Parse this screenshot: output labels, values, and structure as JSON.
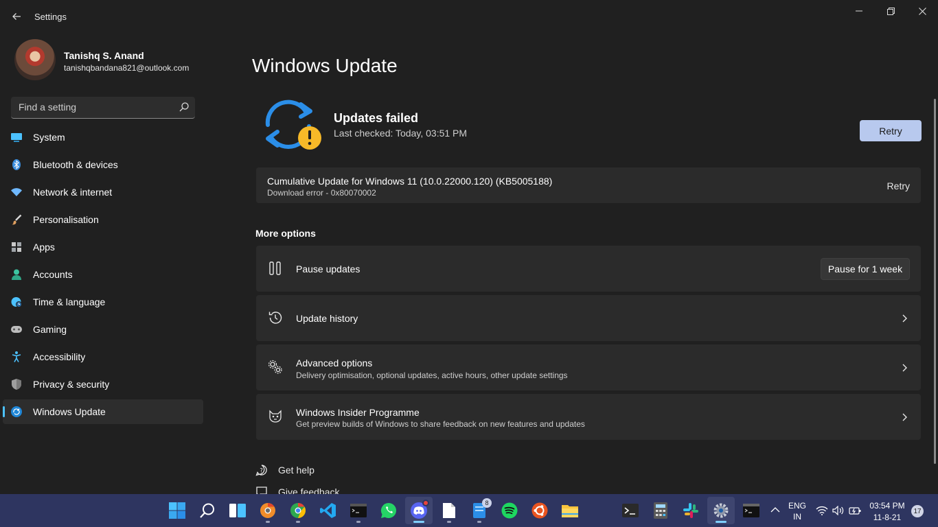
{
  "window": {
    "title": "Settings",
    "controls": [
      "minimize",
      "restore",
      "close"
    ]
  },
  "profile": {
    "name": "Tanishq S. Anand",
    "email": "tanishqbandana821@outlook.com"
  },
  "search": {
    "placeholder": "Find a setting"
  },
  "sidebar": {
    "items": [
      {
        "label": "System",
        "icon": "monitor-icon",
        "color": "#4cc2ff"
      },
      {
        "label": "Bluetooth & devices",
        "icon": "bluetooth-icon",
        "color": "#3a8dde"
      },
      {
        "label": "Network & internet",
        "icon": "wifi-icon",
        "color": "#6fb8ff"
      },
      {
        "label": "Personalisation",
        "icon": "brush-icon",
        "color": "#e0a060"
      },
      {
        "label": "Apps",
        "icon": "apps-icon",
        "color": "#c8c8c8"
      },
      {
        "label": "Accounts",
        "icon": "person-icon",
        "color": "#3cc5a0"
      },
      {
        "label": "Time & language",
        "icon": "globe-clock-icon",
        "color": "#4cc2ff"
      },
      {
        "label": "Gaming",
        "icon": "gamepad-icon",
        "color": "#bdbdbd"
      },
      {
        "label": "Accessibility",
        "icon": "accessibility-icon",
        "color": "#4cc2ff"
      },
      {
        "label": "Privacy & security",
        "icon": "shield-icon",
        "color": "#9e9e9e"
      },
      {
        "label": "Windows Update",
        "icon": "update-icon",
        "color": "#4cc2ff",
        "active": true
      }
    ]
  },
  "main": {
    "title": "Windows Update",
    "status": {
      "title": "Updates failed",
      "subtitle": "Last checked: Today, 03:51 PM",
      "retry_label": "Retry"
    },
    "update_item": {
      "title": "Cumulative Update for Windows 11 (10.0.22000.120) (KB5005188)",
      "subtitle": "Download error - 0x80070002",
      "retry_label": "Retry"
    },
    "more_options_label": "More options",
    "options": [
      {
        "title": "Pause updates",
        "subtitle": "",
        "action_label": "Pause for 1 week",
        "icon": "pause-icon"
      },
      {
        "title": "Update history",
        "subtitle": "",
        "icon": "history-icon"
      },
      {
        "title": "Advanced options",
        "subtitle": "Delivery optimisation, optional updates, active hours, other update settings",
        "icon": "gears-icon"
      },
      {
        "title": "Windows Insider Programme",
        "subtitle": "Get preview builds of Windows to share feedback on new features and updates",
        "icon": "insider-cat-icon"
      }
    ],
    "links": [
      {
        "label": "Get help",
        "icon": "help-icon"
      },
      {
        "label": "Give feedback",
        "icon": "feedback-icon"
      }
    ]
  },
  "taskbar": {
    "apps": [
      {
        "name": "start-button",
        "icon": "windows-logo-icon"
      },
      {
        "name": "search-button",
        "icon": "search-icon"
      },
      {
        "name": "widgets-button",
        "icon": "widgets-icon"
      },
      {
        "name": "chrome-dev-app",
        "icon": "chrome-dev-icon"
      },
      {
        "name": "chrome-canary-app",
        "icon": "chrome-icon"
      },
      {
        "name": "vscode-app",
        "icon": "vscode-icon"
      },
      {
        "name": "terminal-app",
        "icon": "terminal-icon"
      },
      {
        "name": "whatsapp-app",
        "icon": "whatsapp-icon"
      },
      {
        "name": "discord-app",
        "icon": "discord-icon"
      },
      {
        "name": "notepad-app",
        "icon": "file-icon"
      },
      {
        "name": "notes-app",
        "icon": "notes-icon",
        "badge": "8"
      },
      {
        "name": "spotify-app",
        "icon": "spotify-icon"
      },
      {
        "name": "ubuntu-app",
        "icon": "ubuntu-icon"
      },
      {
        "name": "explorer-app",
        "icon": "folder-icon"
      },
      {
        "name": "windows-terminal-app",
        "icon": "terminal-icon"
      },
      {
        "name": "calculator-app",
        "icon": "calculator-icon"
      },
      {
        "name": "slack-app",
        "icon": "slack-icon"
      },
      {
        "name": "settings-app",
        "icon": "gear-icon"
      },
      {
        "name": "cmd-app",
        "icon": "cmd-icon"
      }
    ],
    "language": {
      "line1": "ENG",
      "line2": "IN"
    },
    "clock": {
      "time": "03:54 PM",
      "date": "11-8-21"
    },
    "notification_count": "17"
  }
}
